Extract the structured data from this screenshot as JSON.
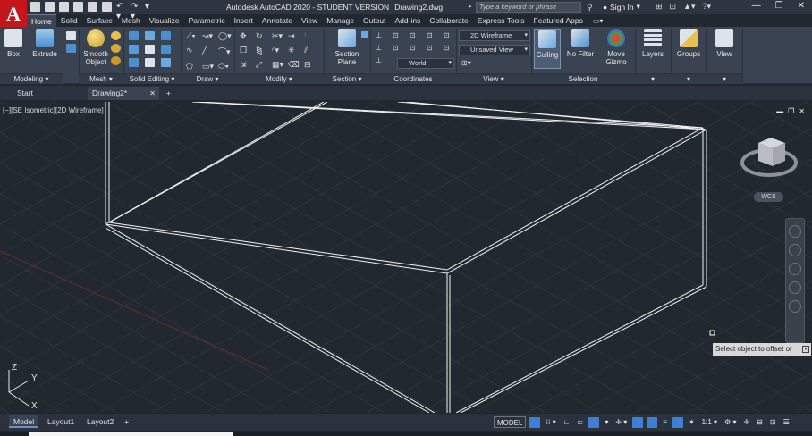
{
  "titlebar": {
    "app_title": "Autodesk AutoCAD 2020 - STUDENT VERSION",
    "file_name": "Drawing2.dwg",
    "search_placeholder": "Type a keyword or phrase",
    "sign_in": "Sign In"
  },
  "tabs": [
    "Home",
    "Solid",
    "Surface",
    "Mesh",
    "Visualize",
    "Parametric",
    "Insert",
    "Annotate",
    "View",
    "Manage",
    "Output",
    "Add-ins",
    "Collaborate",
    "Express Tools",
    "Featured Apps"
  ],
  "active_tab": "Home",
  "ribbon": {
    "modeling": {
      "title": "Modeling",
      "box": "Box",
      "extrude": "Extrude"
    },
    "mesh": {
      "title": "Mesh",
      "smooth_object_1": "Smooth",
      "smooth_object_2": "Object"
    },
    "solid_editing": {
      "title": "Solid Editing"
    },
    "draw": {
      "title": "Draw"
    },
    "modify": {
      "title": "Modify"
    },
    "section": {
      "title": "Section",
      "plane_1": "Section",
      "plane_2": "Plane"
    },
    "coordinates": {
      "title": "Coordinates",
      "ucs_value": "World"
    },
    "view": {
      "title": "View",
      "visual_style": "2D Wireframe",
      "named_view": "Unsaved View"
    },
    "selection": {
      "title": "Selection",
      "culling": "Culling",
      "no_filter": "No Filter",
      "move_gizmo_1": "Move",
      "move_gizmo_2": "Gizmo"
    },
    "layers": {
      "title": "Layers"
    },
    "groups": {
      "title": "Groups"
    },
    "view2": {
      "title": "View"
    }
  },
  "file_tabs": [
    {
      "label": "Start"
    },
    {
      "label": "Drawing2*"
    }
  ],
  "viewport": {
    "label": "[−][SE Isometric][2D Wireframe]",
    "wcs": "WCS",
    "tooltip": "Select object to offset or"
  },
  "ucs": {
    "x": "X",
    "y": "Y",
    "z": "Z"
  },
  "layout_tabs": [
    "Model",
    "Layout1",
    "Layout2"
  ],
  "status": {
    "model": "MODEL",
    "scale": "1:1"
  },
  "colors": {
    "accent": "#c4161c",
    "bg": "#212830",
    "ribbon": "#3a4352",
    "lines": "#f2f2f2"
  }
}
